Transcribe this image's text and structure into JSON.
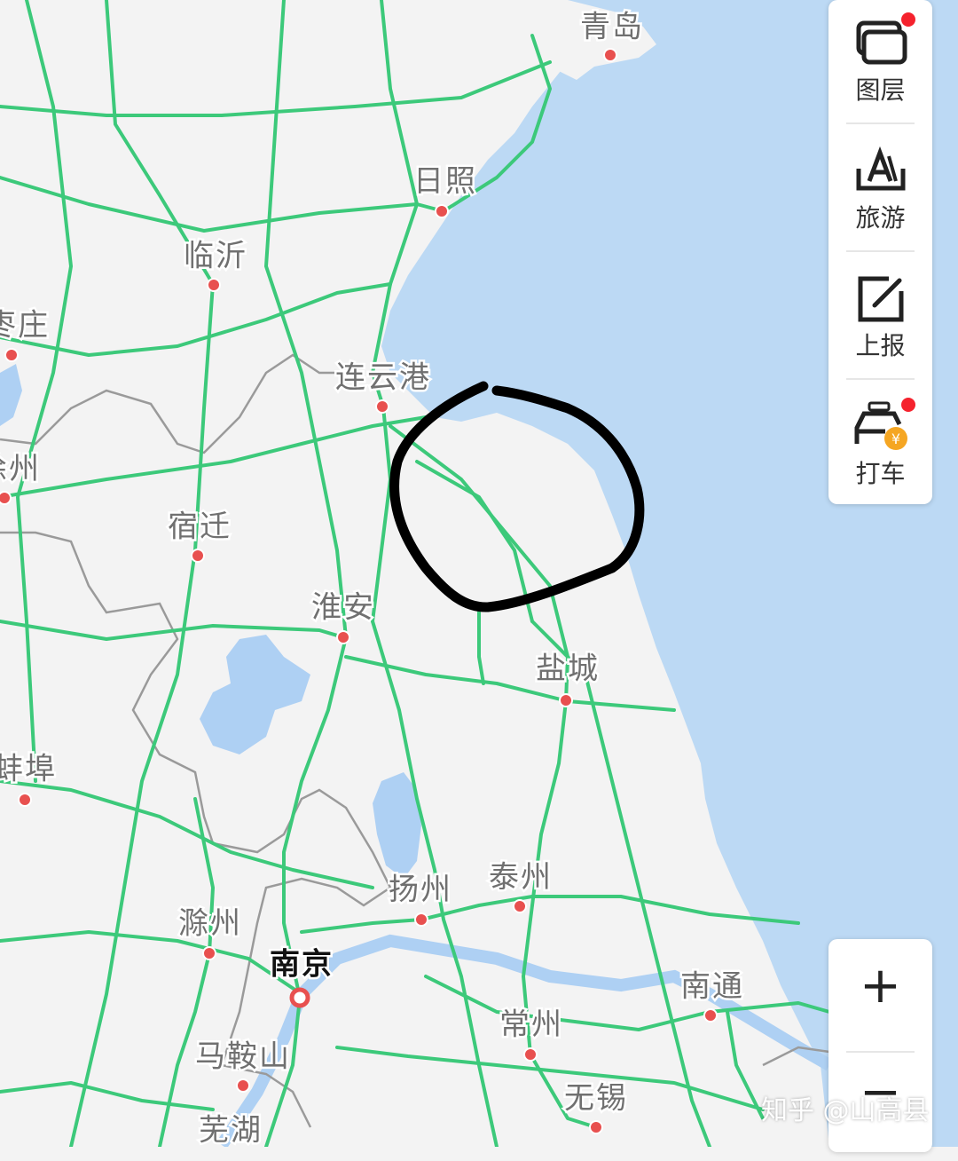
{
  "colors": {
    "land": "#f3f3f3",
    "sea": "#bcd9f4",
    "lake": "#aed0f3",
    "road": "#3cc97a",
    "boundary": "#9a9a9a",
    "city_dot": "#e8504f",
    "annotation": "#000000",
    "badge": "#f5222d"
  },
  "cities": [
    {
      "name": "青岛",
      "type": "city"
    },
    {
      "name": "日照",
      "type": "city"
    },
    {
      "name": "临沂",
      "type": "city"
    },
    {
      "name": "枣庄",
      "type": "city"
    },
    {
      "name": "连云港",
      "type": "city"
    },
    {
      "name": "徐州",
      "type": "city"
    },
    {
      "name": "宿迁",
      "type": "city"
    },
    {
      "name": "淮安",
      "type": "city"
    },
    {
      "name": "盐城",
      "type": "city"
    },
    {
      "name": "蚌埠",
      "type": "city"
    },
    {
      "name": "扬州",
      "type": "city"
    },
    {
      "name": "泰州",
      "type": "city"
    },
    {
      "name": "滁州",
      "type": "city"
    },
    {
      "name": "南京",
      "type": "capital"
    },
    {
      "name": "南通",
      "type": "city"
    },
    {
      "name": "常州",
      "type": "city"
    },
    {
      "name": "马鞍山",
      "type": "city"
    },
    {
      "name": "无锡",
      "type": "city"
    },
    {
      "name": "芜湖",
      "type": "city"
    }
  ],
  "toolbar": {
    "layers_label": "图层",
    "travel_label": "旅游",
    "report_label": "上报",
    "taxi_label": "打车"
  },
  "zoom": {
    "in_label": "+",
    "out_label": "−"
  },
  "watermark": "知乎 @山高县"
}
